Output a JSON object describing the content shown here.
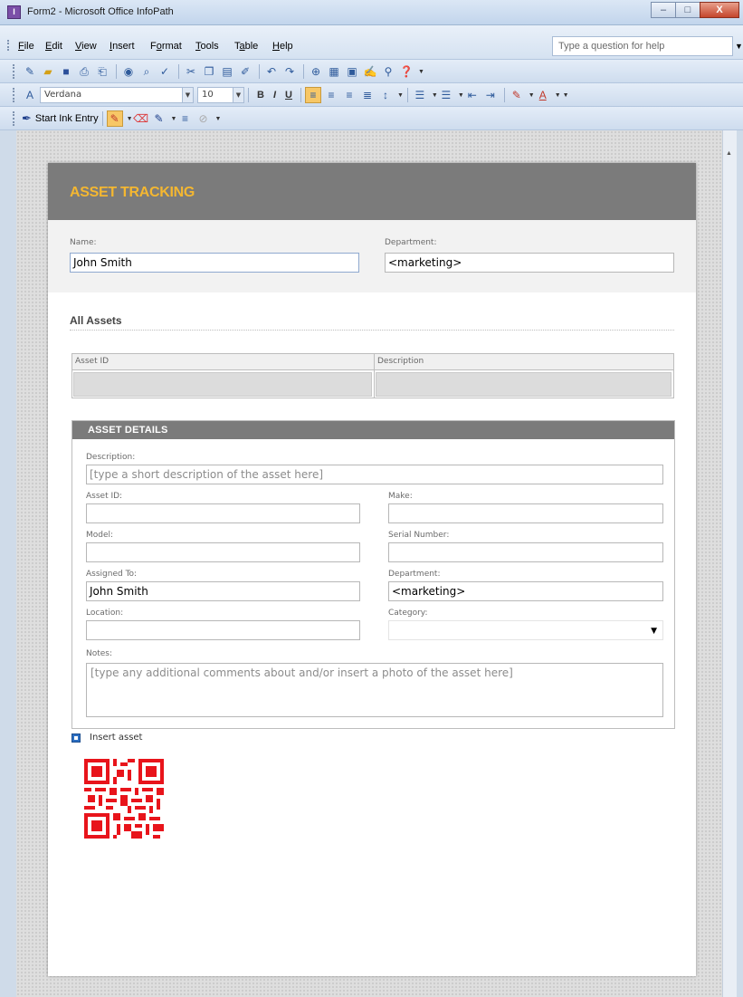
{
  "window": {
    "title": "Form2 - Microsoft Office InfoPath",
    "app_icon_glyph": "I",
    "buttons": {
      "minimize": "–",
      "maximize": "□",
      "close": "X"
    }
  },
  "menu": {
    "items": [
      {
        "label": "File",
        "mnemonic": "F"
      },
      {
        "label": "Edit",
        "mnemonic": "E"
      },
      {
        "label": "View",
        "mnemonic": "V"
      },
      {
        "label": "Insert",
        "mnemonic": "I"
      },
      {
        "label": "Format",
        "mnemonic": "o"
      },
      {
        "label": "Tools",
        "mnemonic": "T"
      },
      {
        "label": "Table",
        "mnemonic": "a"
      },
      {
        "label": "Help",
        "mnemonic": "H"
      }
    ],
    "help_placeholder": "Type a question for help"
  },
  "formatting": {
    "font_name": "Verdana",
    "font_size": "10",
    "bold": "B",
    "italic": "I",
    "underline": "U"
  },
  "ink_toolbar": {
    "start_ink_label": "Start Ink Entry"
  },
  "form": {
    "banner_title": "ASSET TRACKING",
    "name_label": "Name:",
    "name_value": "John Smith",
    "department_label": "Department:",
    "department_value": "<marketing>",
    "all_assets_title": "All Assets",
    "table": {
      "columns": [
        "Asset ID",
        "Description"
      ]
    },
    "details": {
      "title": "ASSET DETAILS",
      "description_label": "Description:",
      "description_placeholder": "[type a short description of the asset here]",
      "asset_id_label": "Asset ID:",
      "make_label": "Make:",
      "model_label": "Model:",
      "serial_label": "Serial Number:",
      "assigned_to_label": "Assigned To:",
      "assigned_to_value": "John Smith",
      "department_label": "Department:",
      "department_value": "<marketing>",
      "location_label": "Location:",
      "category_label": "Category:",
      "category_value": "",
      "notes_label": "Notes:",
      "notes_placeholder": "[type any additional comments about and/or insert a photo of the asset here]"
    },
    "insert_asset_label": "Insert asset"
  },
  "colors": {
    "banner_bg": "#7b7b7b",
    "banner_title": "#f4b731",
    "qr_red": "#e8141b"
  },
  "icons": [
    "new-icon",
    "open-icon",
    "save-icon",
    "print-preview-icon",
    "print-icon",
    "spelling-icon",
    "cut-icon",
    "copy-icon",
    "paste-icon",
    "undo-icon",
    "redo-icon",
    "help-icon",
    "pen-icon",
    "eraser-icon",
    "qr-code-icon"
  ]
}
